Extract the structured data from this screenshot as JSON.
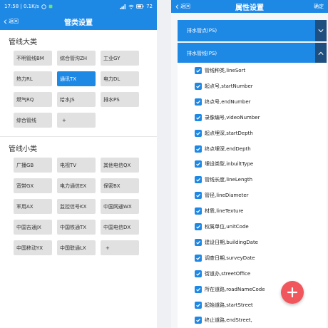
{
  "left": {
    "status": {
      "time_net": "17:58 | 0.1K/s",
      "right": "72"
    },
    "appbar": {
      "back": "返回",
      "title": "管类设置"
    },
    "big_category": {
      "title": "管线大类",
      "chips": [
        {
          "label": "不明管线BM",
          "selected": false
        },
        {
          "label": "综合管沟ZH",
          "selected": false
        },
        {
          "label": "工业GY",
          "selected": false
        },
        {
          "label": "热力RL",
          "selected": false
        },
        {
          "label": "通讯TX",
          "selected": true
        },
        {
          "label": "电力DL",
          "selected": false
        },
        {
          "label": "燃气RQ",
          "selected": false
        },
        {
          "label": "给水JS",
          "selected": false
        },
        {
          "label": "排水PS",
          "selected": false
        },
        {
          "label": "综合管线",
          "selected": false
        },
        {
          "label": "+",
          "selected": false
        }
      ]
    },
    "small_category": {
      "title": "管线小类",
      "chips": [
        {
          "label": "广播GB"
        },
        {
          "label": "电视TV"
        },
        {
          "label": "其他电信QX"
        },
        {
          "label": "宽带GX"
        },
        {
          "label": "电力通信EX"
        },
        {
          "label": "保密BX"
        },
        {
          "label": "军用AX"
        },
        {
          "label": "监控信号KX"
        },
        {
          "label": "中国网通WX"
        },
        {
          "label": "中国吉通JX"
        },
        {
          "label": "中国铁通TX"
        },
        {
          "label": "中国电信DX"
        },
        {
          "label": "中国移动YX"
        },
        {
          "label": "中国联通LX"
        },
        {
          "label": "+"
        }
      ]
    }
  },
  "right": {
    "appbar": {
      "back": "返回",
      "title": "属性设置",
      "confirm": "确定"
    },
    "groups": [
      {
        "label": "排水管点(PS)",
        "expanded": false
      },
      {
        "label": "排水管线(PS)",
        "expanded": true
      }
    ],
    "attributes": [
      "管线种类,lineSort",
      "起点号,startNumber",
      "终点号,endNumber",
      "录像编号,videoNumber",
      "起点埋深,startDepth",
      "终点埋深,endDepth",
      "埋设类型,inbuiltType",
      "管线长度,lineLength",
      "管径,lineDiameter",
      "材质,lineTexture",
      "权属单位,unitCode",
      "建设日期,buildingDate",
      "调查日期,surveyDate",
      "街道办,streetOffice",
      "所在道路,roadNameCode",
      "起始道路,startStreet",
      "终止道路,endStreet,"
    ],
    "fab_label": "+"
  },
  "colors": {
    "primary": "#1e88e5",
    "chip_bg": "#e1e1e1",
    "fab": "#f0565c",
    "header_arrow_bg": "#1e4f7e"
  }
}
